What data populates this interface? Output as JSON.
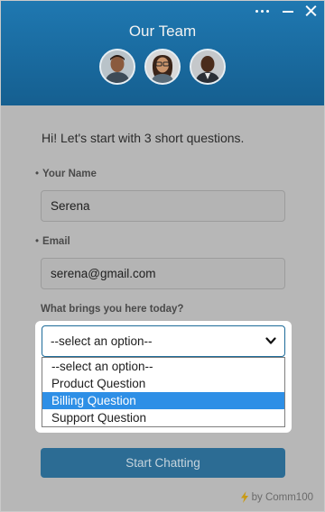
{
  "header": {
    "title": "Our Team",
    "colors": {
      "background": "#1a6ea5",
      "title": "#f2f2f2"
    }
  },
  "window_controls": [
    "more-icon",
    "minimize-icon",
    "close-icon"
  ],
  "team_avatars": [
    "avatar-1",
    "avatar-2",
    "avatar-3"
  ],
  "form": {
    "greeting": "Hi! Let's start with 3 short questions.",
    "name": {
      "label": "Your Name",
      "value": "Serena",
      "required_marker": "•"
    },
    "email": {
      "label": "Email",
      "value": "serena@gmail.com",
      "required_marker": "•"
    },
    "topic": {
      "label": "What brings you here today?",
      "selected_value": "--select an option--",
      "options": [
        "--select an option--",
        "Product Question",
        "Billing Question",
        "Support Question"
      ],
      "highlighted_option": "Billing Question"
    },
    "submit_label": "Start Chatting"
  },
  "footer": {
    "powered_by": "by Comm100",
    "icon": "bolt-icon"
  },
  "colors": {
    "accent": "#2c6c94",
    "highlight": "#2e8fe6",
    "overlay": "#b7b7b7"
  }
}
